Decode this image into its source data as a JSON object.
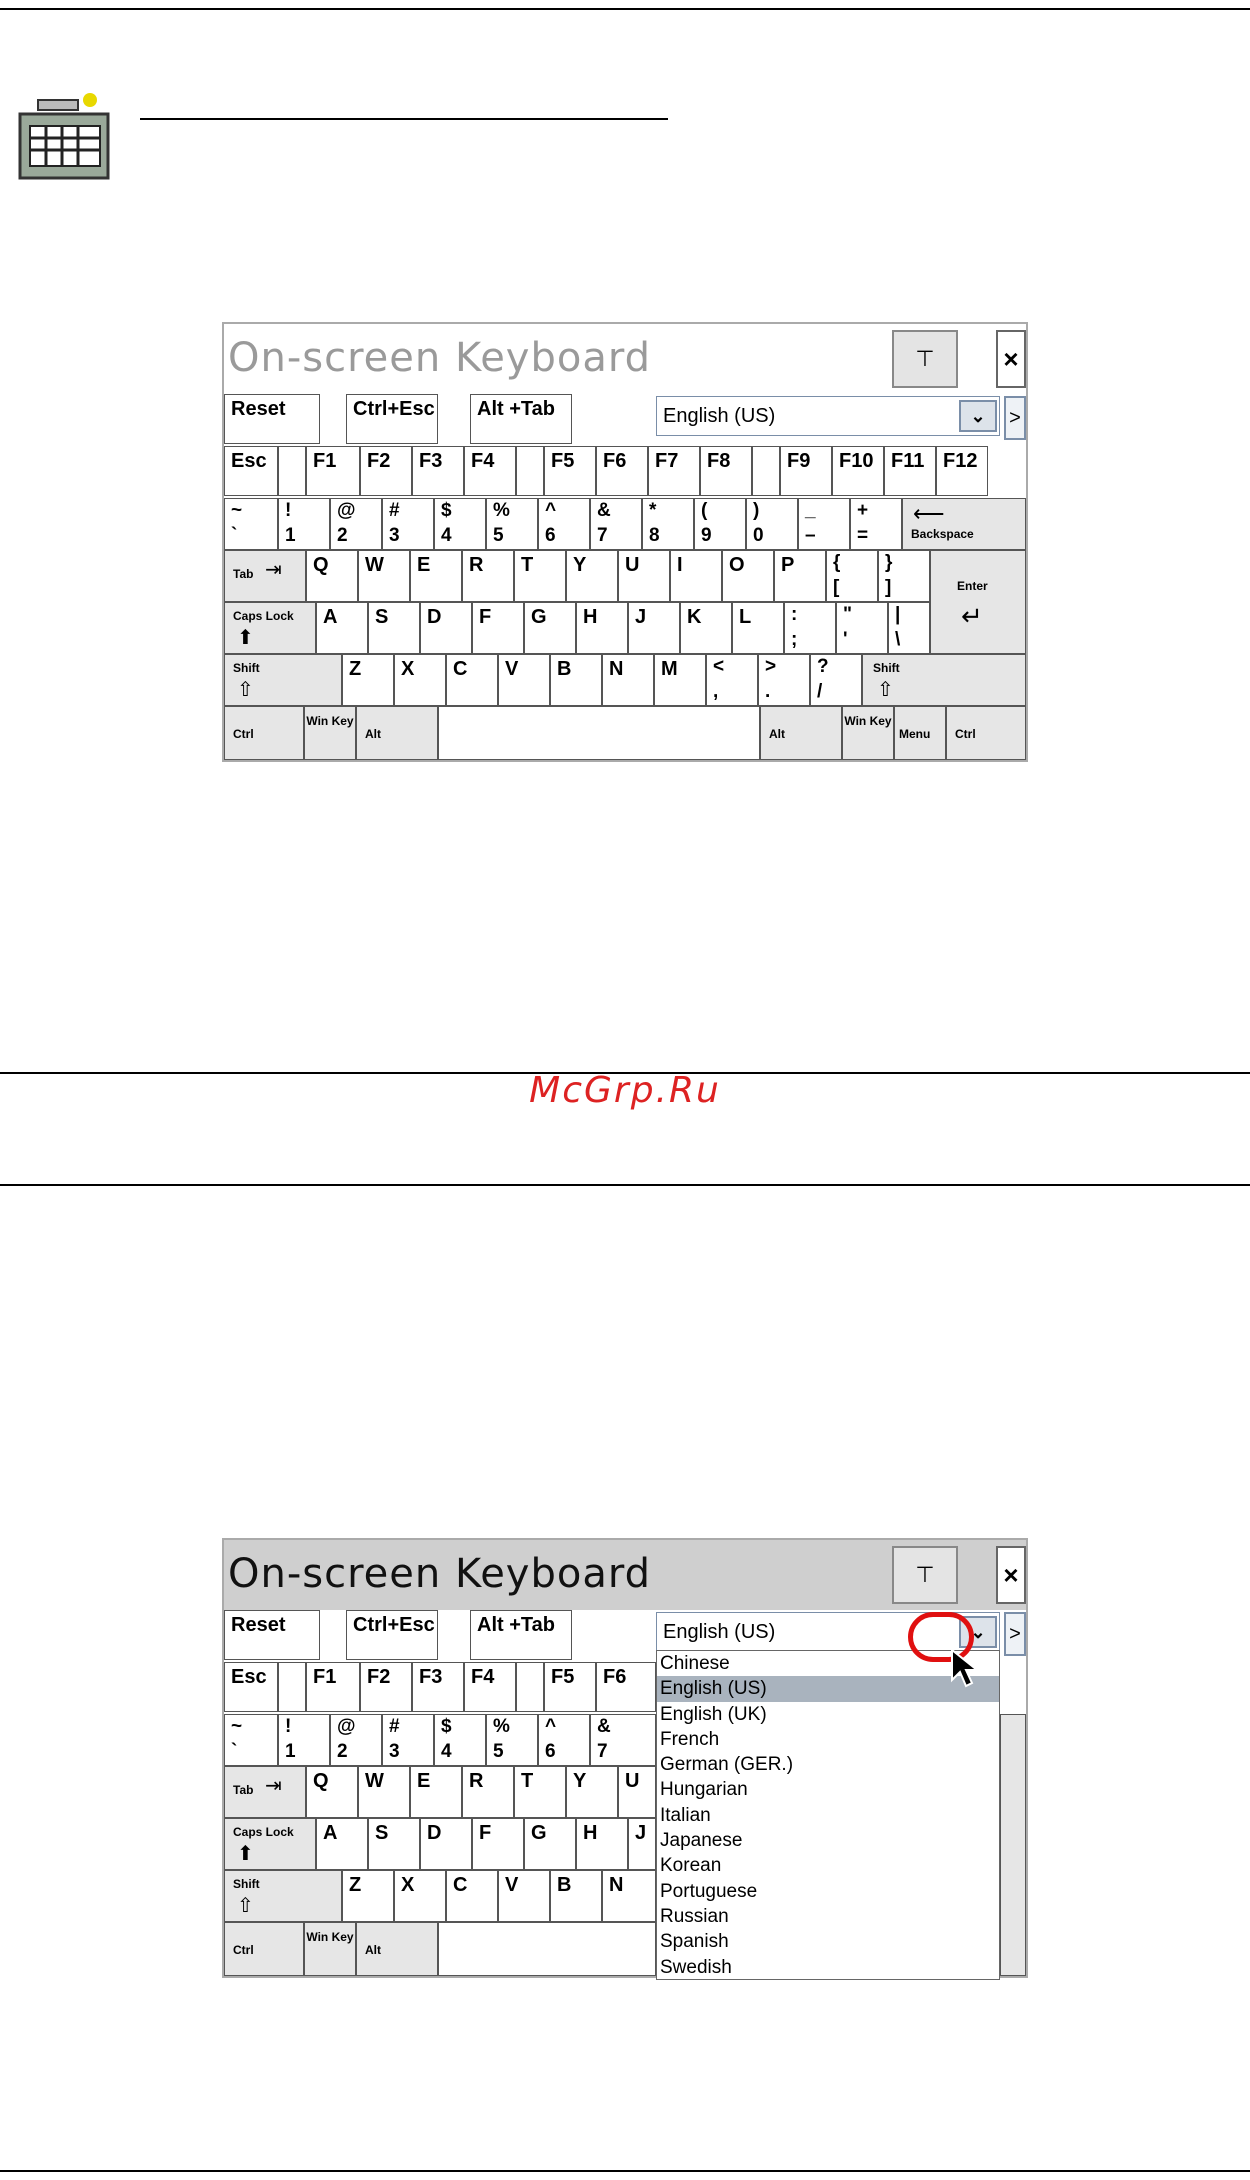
{
  "watermark": "McGrp.Ru",
  "app_icon": "keyboard-icon",
  "keyboard": {
    "title": "On-screen Keyboard",
    "pin_label": "⊤",
    "close_label": "×",
    "more_label": ">",
    "dropdown_arrow": "⌄",
    "top_keys": {
      "reset": "Reset",
      "ctrl_esc": "Ctrl+Esc",
      "alt_tab": "Alt +Tab"
    },
    "language_value": "English (US)",
    "function_keys": [
      "Esc",
      "F1",
      "F2",
      "F3",
      "F4",
      "F5",
      "F6",
      "F7",
      "F8",
      "F9",
      "F10",
      "F11",
      "F12"
    ],
    "number_keys": [
      {
        "shift": "~",
        "base": "`"
      },
      {
        "shift": "!",
        "base": "1"
      },
      {
        "shift": "@",
        "base": "2"
      },
      {
        "shift": "#",
        "base": "3"
      },
      {
        "shift": "$",
        "base": "4"
      },
      {
        "shift": "%",
        "base": "5"
      },
      {
        "shift": "^",
        "base": "6"
      },
      {
        "shift": "&",
        "base": "7"
      },
      {
        "shift": "*",
        "base": "8"
      },
      {
        "shift": "(",
        "base": "9"
      },
      {
        "shift": ")",
        "base": "0"
      },
      {
        "shift": "_",
        "base": "–"
      },
      {
        "shift": "+",
        "base": "="
      }
    ],
    "backspace_label": "Backspace",
    "tab_label": "Tab",
    "row_q": [
      "Q",
      "W",
      "E",
      "R",
      "T",
      "Y",
      "U",
      "I",
      "O",
      "P"
    ],
    "row_q_extra": [
      {
        "shift": "{",
        "base": "["
      },
      {
        "shift": "}",
        "base": "]"
      }
    ],
    "enter_label": "Enter",
    "caps_label": "Caps Lock",
    "row_a": [
      "A",
      "S",
      "D",
      "F",
      "G",
      "H",
      "J",
      "K",
      "L"
    ],
    "row_a_extra": [
      {
        "shift": ":",
        "base": ";"
      },
      {
        "shift": "\"",
        "base": "'"
      },
      {
        "shift": "|",
        "base": "\\"
      }
    ],
    "shift_label": "Shift",
    "row_z": [
      "Z",
      "X",
      "C",
      "V",
      "B",
      "N",
      "M"
    ],
    "row_z_extra": [
      {
        "shift": "<",
        "base": ","
      },
      {
        "shift": ">",
        "base": "."
      },
      {
        "shift": "?",
        "base": "/"
      }
    ],
    "bottom": {
      "ctrl": "Ctrl",
      "win": "Win Key",
      "alt": "Alt",
      "menu": "Menu"
    }
  },
  "language_options": [
    "Chinese",
    "English (US)",
    "English (UK)",
    "French",
    "German (GER.)",
    "Hungarian",
    "Italian",
    "Japanese",
    "Korean",
    "Portuguese",
    "Russian",
    "Spanish",
    "Swedish"
  ],
  "selected_language": "English (US)"
}
